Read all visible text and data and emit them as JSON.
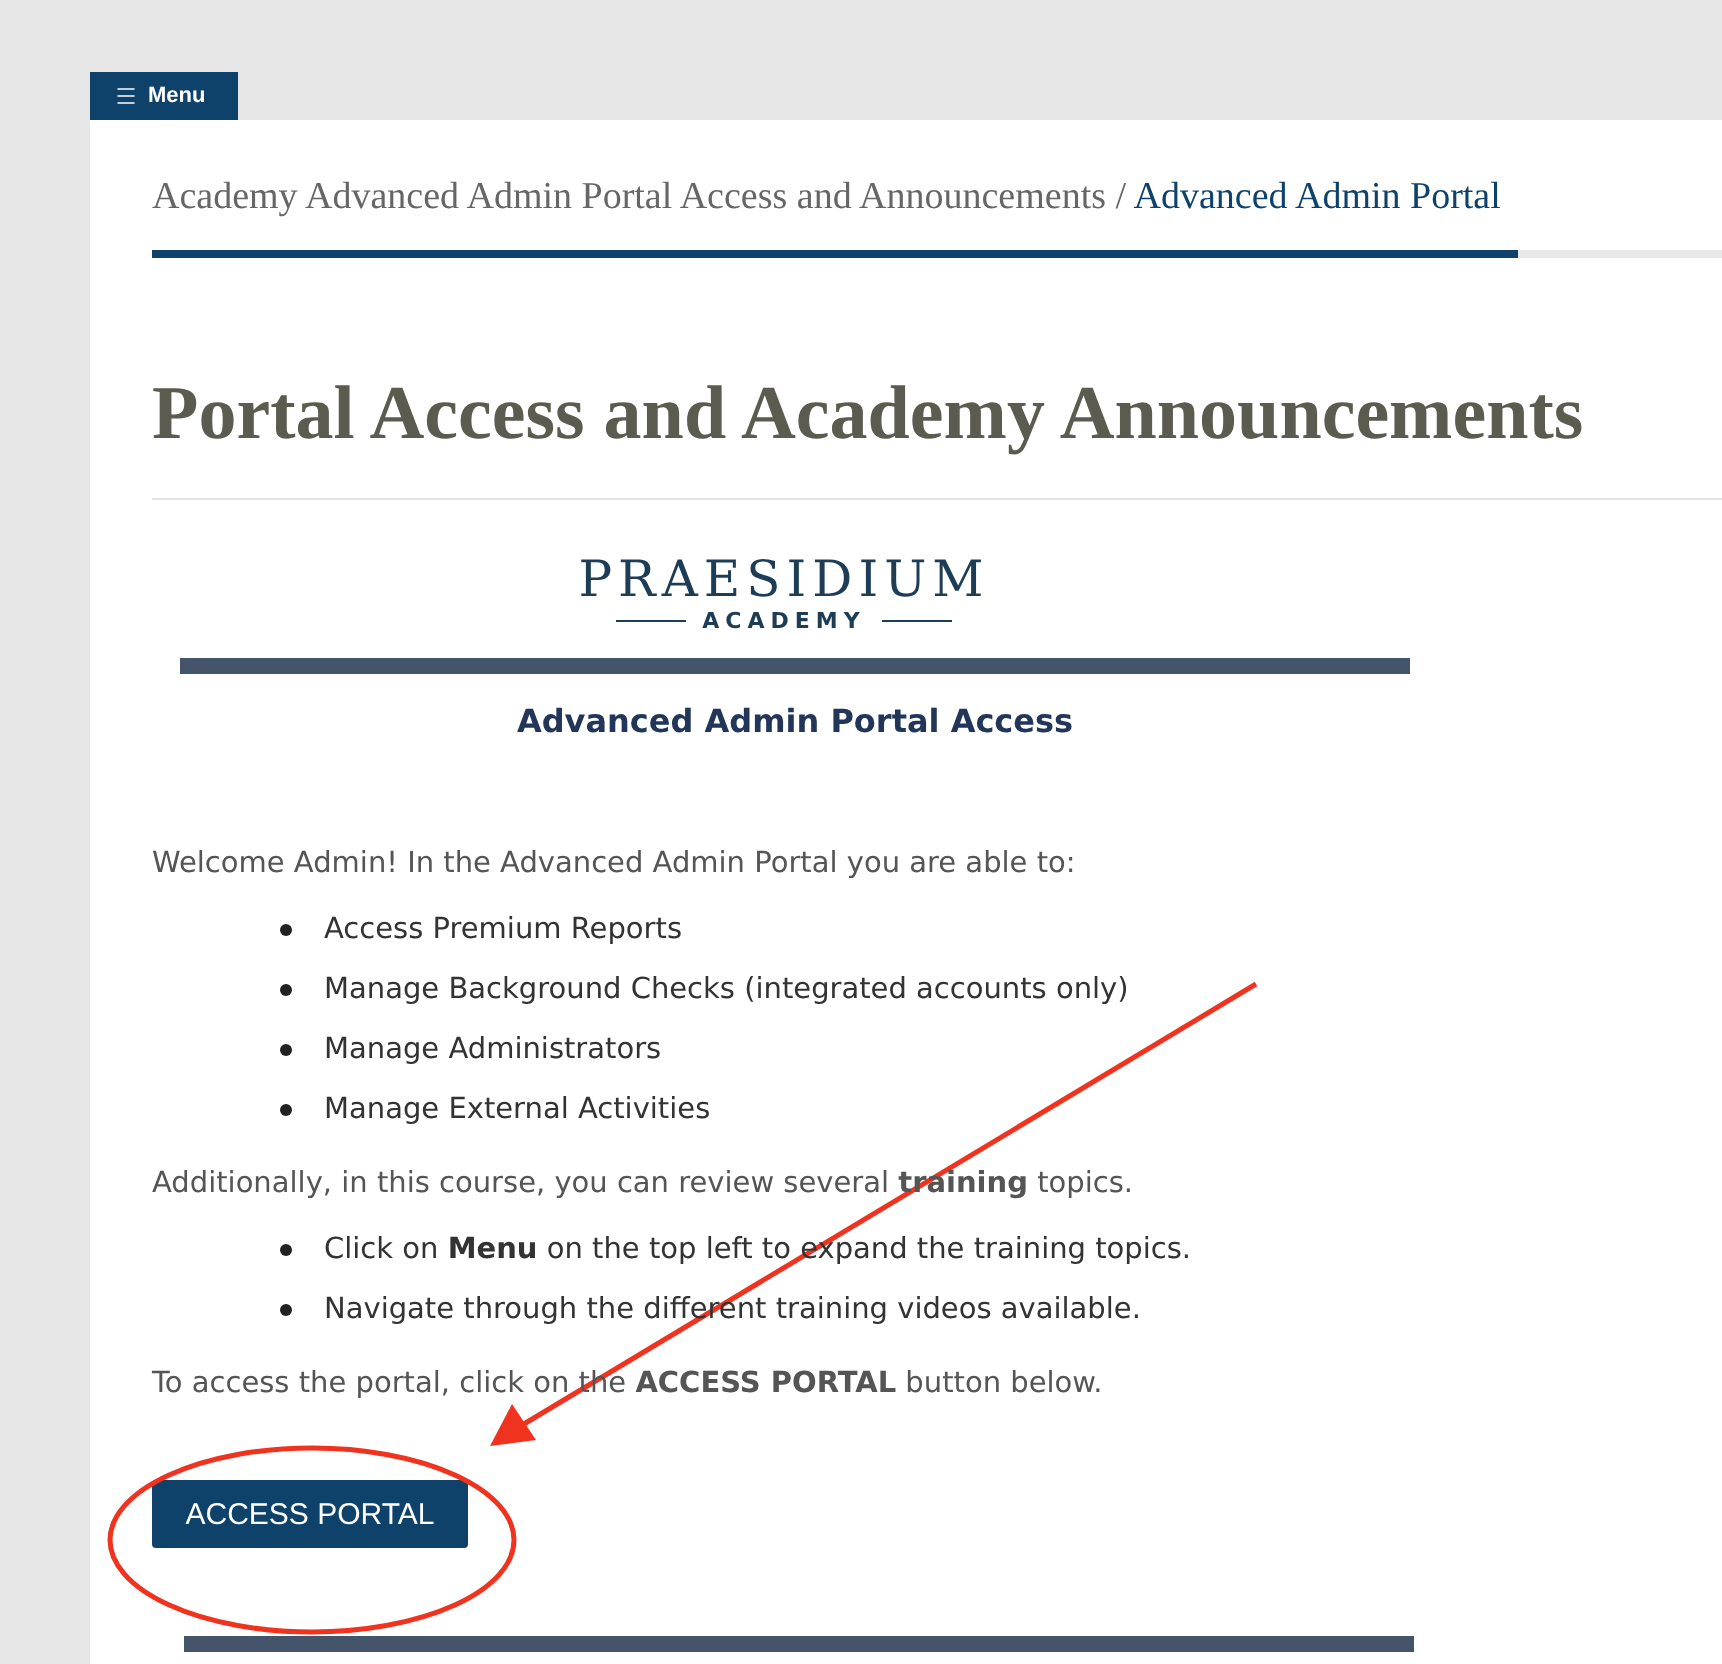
{
  "menu_button": {
    "label": "Menu"
  },
  "breadcrumb": {
    "parent": "Academy Advanced Admin Portal Access and Announcements",
    "separator": "/",
    "current": "Advanced Admin Portal"
  },
  "progress": {
    "level": 0.87
  },
  "title": "Portal Access and Academy Announcements",
  "logo": {
    "name": "PRAESIDIUM",
    "subtitle": "ACADEMY"
  },
  "section_heading": "Advanced Admin Portal Access",
  "intro": "Welcome Admin! In the Advanced Admin Portal you are able to:",
  "features": [
    "Access Premium Reports",
    "Manage Background Checks (integrated accounts only)",
    "Manage Administrators",
    "Manage External Activities"
  ],
  "training_intro": "Additionally, in this course, you can review several **training** topics.",
  "training_steps": [
    "Click on **Menu** on the top left to expand the training topics.",
    "Navigate through the different training videos available."
  ],
  "access_note": "To access the portal, click on the **ACCESS PORTAL** button below.",
  "access_button": {
    "label": "ACCESS PORTAL"
  }
}
